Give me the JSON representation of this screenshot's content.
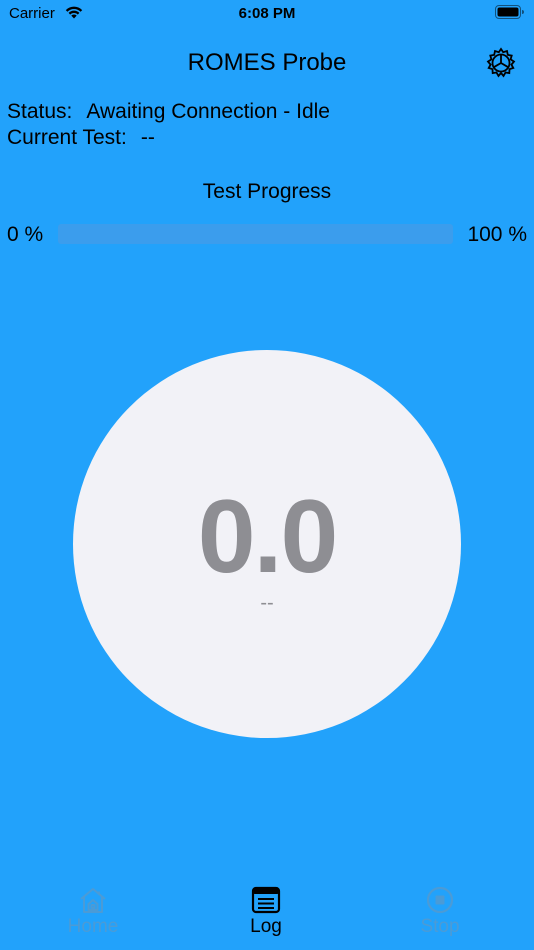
{
  "status_bar": {
    "carrier": "Carrier",
    "time": "6:08 PM"
  },
  "nav": {
    "title": "ROMES Probe",
    "settings_icon": "gear-icon"
  },
  "status": {
    "status_label": "Status:",
    "status_value": "Awaiting Connection - Idle",
    "test_label": "Current Test:",
    "test_value": "--"
  },
  "progress": {
    "title": "Test Progress",
    "min_label": "0 %",
    "max_label": "100 %",
    "value_fraction": 0
  },
  "gauge": {
    "value": "0.0",
    "unit": "--"
  },
  "tabs": [
    {
      "label": "Home",
      "icon": "home-icon",
      "selected": false
    },
    {
      "label": "Log",
      "icon": "log-icon",
      "selected": true
    },
    {
      "label": "Stop",
      "icon": "stop-icon",
      "selected": false
    }
  ],
  "colors": {
    "background": "#22a2fb",
    "gauge_fill": "#f2f2f7",
    "gauge_text": "#8e8e93",
    "tab_inactive": "#4b9bd6",
    "tab_active": "#000000"
  }
}
